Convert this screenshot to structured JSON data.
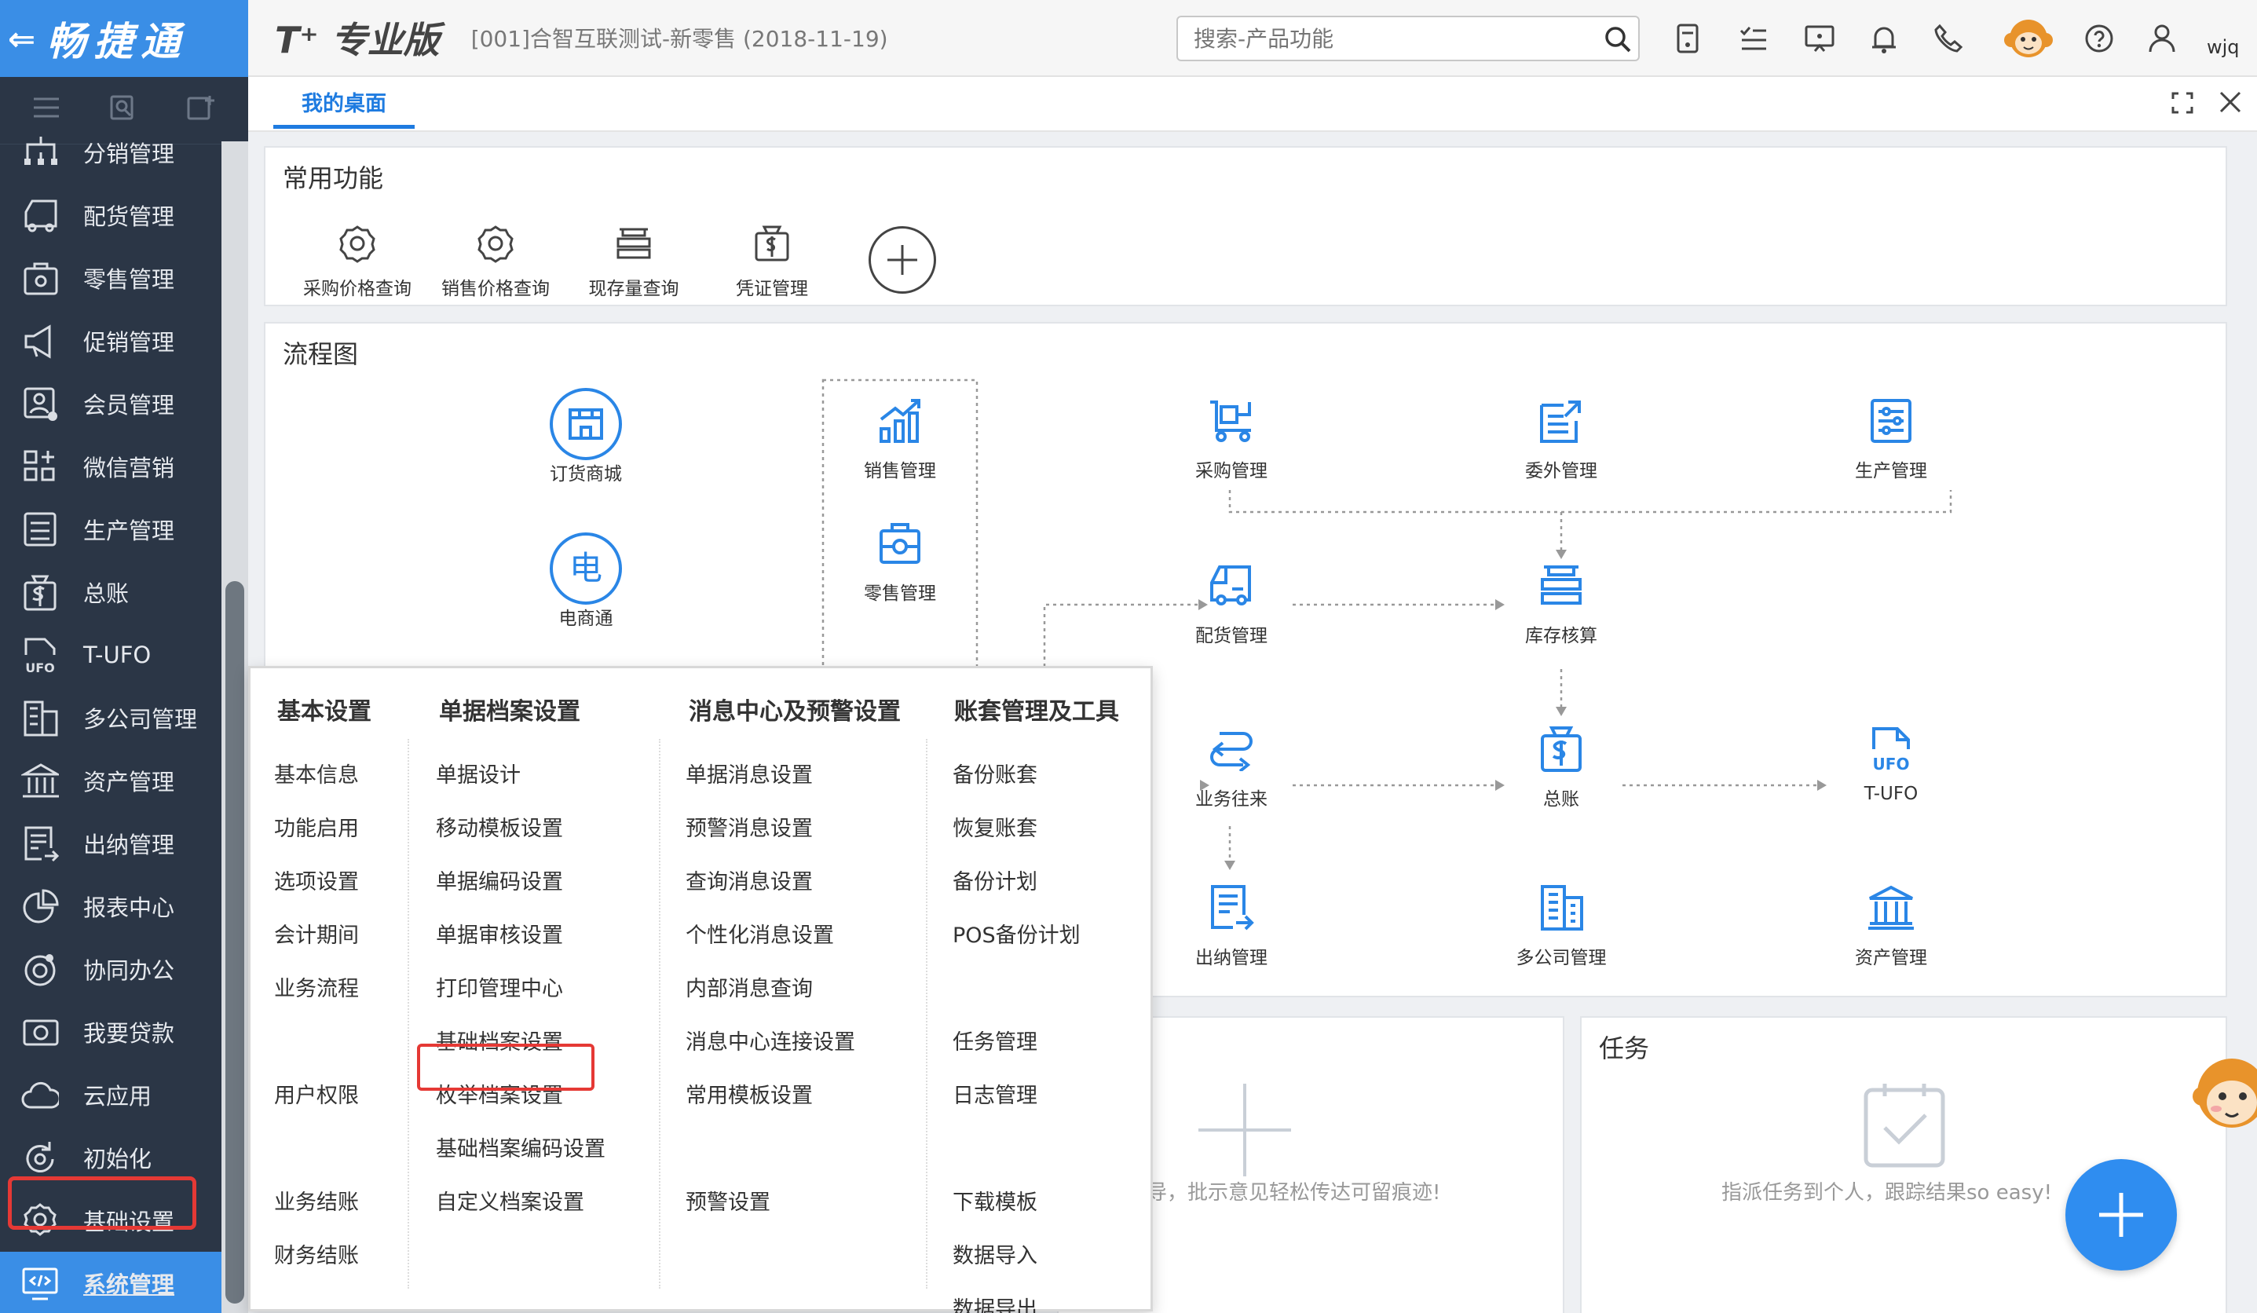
{
  "brand": {
    "back_icon": "arrow-left-icon",
    "name": "畅捷通"
  },
  "header": {
    "product": "T⁺ 专业版",
    "company": "[001]合智互联测试-新零售  (2018-11-19)",
    "search_placeholder": "搜索-产品功能",
    "user": "wjq",
    "icons": [
      "calculator-icon",
      "checklist-icon",
      "monitor-icon",
      "bell-icon",
      "phone-icon",
      "monkey-avatar",
      "help-icon",
      "user-icon"
    ]
  },
  "sidebar": {
    "tools": [
      "menu-icon",
      "search-doc-icon",
      "add-doc-icon"
    ],
    "items": [
      {
        "label": "分销管理",
        "icon": "sitemap-icon"
      },
      {
        "label": "配货管理",
        "icon": "truck-icon"
      },
      {
        "label": "零售管理",
        "icon": "shop-bag-icon"
      },
      {
        "label": "促销管理",
        "icon": "megaphone-icon"
      },
      {
        "label": "会员管理",
        "icon": "member-icon"
      },
      {
        "label": "微信营销",
        "icon": "wechat-grid-icon"
      },
      {
        "label": "生产管理",
        "icon": "production-icon"
      },
      {
        "label": "总账",
        "icon": "ledger-icon"
      },
      {
        "label": "T-UFO",
        "icon": "ufo-icon"
      },
      {
        "label": "多公司管理",
        "icon": "building-icon"
      },
      {
        "label": "资产管理",
        "icon": "bank-icon"
      },
      {
        "label": "出纳管理",
        "icon": "cashier-icon"
      },
      {
        "label": "报表中心",
        "icon": "pie-chart-icon"
      },
      {
        "label": "协同办公",
        "icon": "collab-icon"
      },
      {
        "label": "我要贷款",
        "icon": "loan-icon"
      },
      {
        "label": "云应用",
        "icon": "cloud-icon"
      },
      {
        "label": "初始化",
        "icon": "refresh-icon"
      },
      {
        "label": "基础设置",
        "icon": "gear-icon"
      },
      {
        "label": "系统管理",
        "icon": "code-monitor-icon"
      }
    ]
  },
  "tabs": {
    "desk": "我的桌面"
  },
  "common": {
    "title": "常用功能",
    "items": [
      "采购价格查询",
      "销售价格查询",
      "现存量查询",
      "凭证管理"
    ],
    "add_icon": "plus-circle-icon"
  },
  "flow": {
    "title": "流程图",
    "nodes": {
      "order_mall": "订货商城",
      "ecommerce": "电商通",
      "ecommerce_glyph": "电",
      "sales": "销售管理",
      "retail": "零售管理",
      "purchase": "采购管理",
      "outsource": "委外管理",
      "production": "生产管理",
      "distribution": "配货管理",
      "inventory": "库存核算",
      "business": "业务往来",
      "gl": "总账",
      "tufo": "T-UFO",
      "cashier": "出纳管理",
      "multi": "多公司管理",
      "asset": "资产管理"
    }
  },
  "memo": {
    "text": "导，批示意见轻松传达可留痕迹!"
  },
  "task": {
    "title": "任务",
    "text": "指派任务到个人，跟踪结果so easy!"
  },
  "menu": {
    "col1": {
      "title": "基本设置",
      "items": [
        "基本信息",
        "功能启用",
        "选项设置",
        "会计期间",
        "业务流程",
        "用户权限",
        "业务结账",
        "财务结账"
      ]
    },
    "col2": {
      "title": "单据档案设置",
      "items": [
        "单据设计",
        "移动模板设置",
        "单据编码设置",
        "单据审核设置",
        "打印管理中心",
        "基础档案设置",
        "枚举档案设置",
        "基础档案编码设置",
        "自定义档案设置"
      ]
    },
    "col3": {
      "title": "消息中心及预警设置",
      "items": [
        "单据消息设置",
        "预警消息设置",
        "查询消息设置",
        "个性化消息设置",
        "内部消息查询",
        "消息中心连接设置",
        "常用模板设置",
        "预警设置"
      ]
    },
    "col4": {
      "title": "账套管理及工具",
      "items": [
        "备份账套",
        "恢复账套",
        "备份计划",
        "POS备份计划",
        "任务管理",
        "日志管理",
        "下载模板",
        "数据导入",
        "数据导出"
      ]
    }
  },
  "colors": {
    "brand": "#3a8ee6",
    "sidebar": "#2b3646",
    "accent": "#2f8df0",
    "highlight": "#e53935"
  }
}
